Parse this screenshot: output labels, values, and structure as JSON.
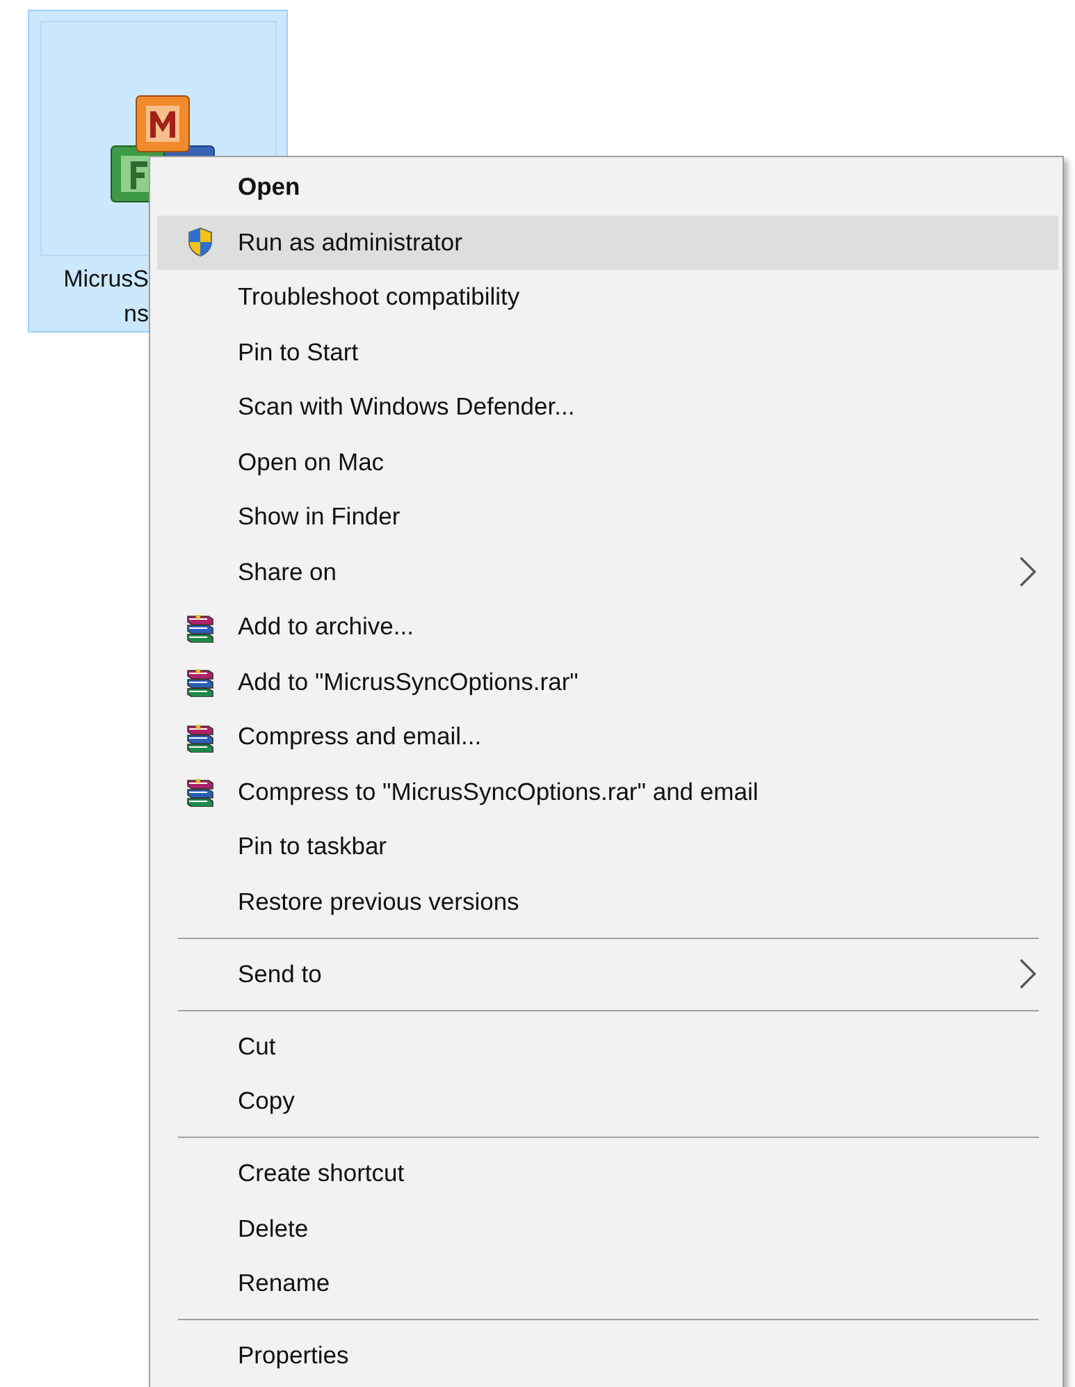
{
  "desktop_icon": {
    "selected": true,
    "label_lines": [
      "MicrusS",
      "ns"
    ]
  },
  "context_menu": {
    "items": [
      {
        "kind": "plain",
        "label": "Open",
        "default": true,
        "selected": false
      },
      {
        "kind": "shield",
        "label": "Run as administrator",
        "default": false,
        "selected": true
      },
      {
        "kind": "plain",
        "label": "Troubleshoot compatibility",
        "default": false,
        "selected": false
      },
      {
        "kind": "plain",
        "label": "Pin to Start",
        "default": false,
        "selected": false
      },
      {
        "kind": "plain",
        "label": "Scan with Windows Defender...",
        "default": false,
        "selected": false
      },
      {
        "kind": "plain",
        "label": "Open on Mac",
        "default": false,
        "selected": false
      },
      {
        "kind": "plain",
        "label": "Show in Finder",
        "default": false,
        "selected": false
      },
      {
        "kind": "submenu",
        "label": "Share on",
        "default": false,
        "selected": false
      },
      {
        "kind": "archive",
        "label": "Add to archive...",
        "default": false,
        "selected": false
      },
      {
        "kind": "archive",
        "label": "Add to \"MicrusSyncOptions.rar\"",
        "default": false,
        "selected": false
      },
      {
        "kind": "archive",
        "label": "Compress and email...",
        "default": false,
        "selected": false
      },
      {
        "kind": "archive",
        "label": "Compress to \"MicrusSyncOptions.rar\" and email",
        "default": false,
        "selected": false
      },
      {
        "kind": "plain",
        "label": "Pin to taskbar",
        "default": false,
        "selected": false
      },
      {
        "kind": "plain",
        "label": "Restore previous versions",
        "default": false,
        "selected": false
      },
      {
        "kind": "separator"
      },
      {
        "kind": "submenu",
        "label": "Send to",
        "default": false,
        "selected": false
      },
      {
        "kind": "separator"
      },
      {
        "kind": "plain",
        "label": "Cut",
        "default": false,
        "selected": false
      },
      {
        "kind": "plain",
        "label": "Copy",
        "default": false,
        "selected": false
      },
      {
        "kind": "separator"
      },
      {
        "kind": "plain",
        "label": "Create shortcut",
        "default": false,
        "selected": false
      },
      {
        "kind": "plain",
        "label": "Delete",
        "default": false,
        "selected": false
      },
      {
        "kind": "plain",
        "label": "Rename",
        "default": false,
        "selected": false
      },
      {
        "kind": "separator"
      },
      {
        "kind": "plain",
        "label": "Properties",
        "default": false,
        "selected": false
      }
    ]
  }
}
